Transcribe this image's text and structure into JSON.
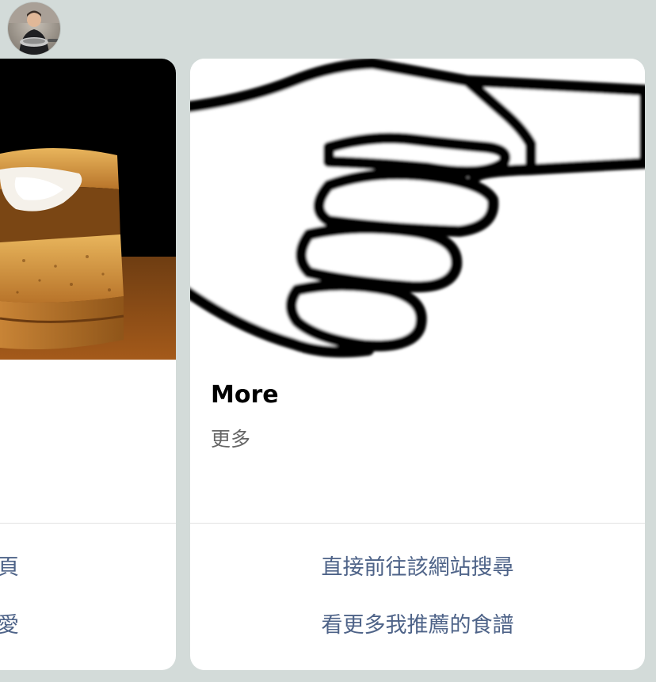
{
  "profile": {
    "avatar_icon": "chef-avatar-icon"
  },
  "cards": [
    {
      "image_icon": "toasted-sandwich-photo",
      "actions": [
        "頁",
        "愛"
      ]
    },
    {
      "image_icon": "pointing-hand-icon",
      "title": "More",
      "description": "更多",
      "actions": [
        "直接前往該網站搜尋",
        "看更多我推薦的食譜"
      ]
    }
  ],
  "colors": {
    "background": "#d3dbd9",
    "card": "#ffffff",
    "action_text": "#4e6388",
    "description_text": "#666666",
    "divider": "#e3e3e3"
  }
}
